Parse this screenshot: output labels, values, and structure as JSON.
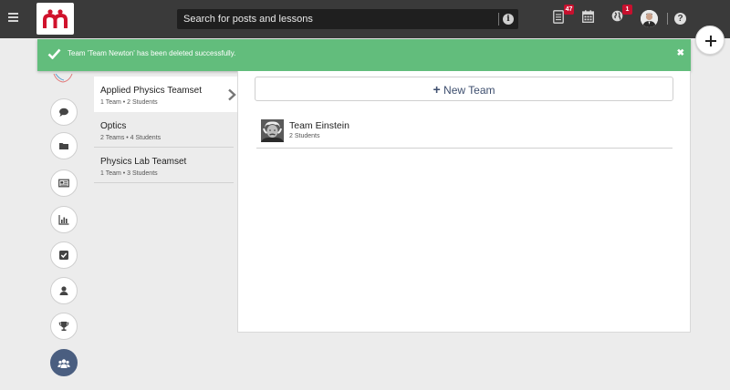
{
  "header": {
    "search_placeholder": "Search for posts and lessons",
    "notifications": [
      {
        "icon": "document-icon",
        "badge": "47"
      },
      {
        "icon": "calendar-icon",
        "badge": ""
      },
      {
        "icon": "globe-icon",
        "badge": "1"
      }
    ],
    "help_label": "?"
  },
  "toast": {
    "message": "Team 'Team Newton' has been deleted successfully.",
    "close": "✖"
  },
  "sidebar": {
    "items": [
      {
        "name": "comment-icon"
      },
      {
        "name": "folder-icon"
      },
      {
        "name": "newspaper-icon"
      },
      {
        "name": "bar-chart-icon"
      },
      {
        "name": "checkbox-icon"
      },
      {
        "name": "user-icon"
      },
      {
        "name": "trophy-icon"
      },
      {
        "name": "group-icon",
        "active": true
      }
    ]
  },
  "teamsets": [
    {
      "name": "Applied Physics Teamset",
      "meta": "1 Team • 2 Students",
      "selected": true
    },
    {
      "name": "Optics",
      "meta": "2 Teams • 4 Students"
    },
    {
      "name": "Physics Lab Teamset",
      "meta": "1 Team • 3 Students"
    }
  ],
  "main": {
    "new_team_plus": "+",
    "new_team_label": "New Team",
    "teams": [
      {
        "name": "Team Einstein",
        "meta": "2 Students"
      }
    ]
  },
  "colors": {
    "topbar": "#3a3a3a",
    "toast": "#62bd7c",
    "accent": "#4a5e80",
    "badge": "#c8102e",
    "brand": "#d0122c"
  }
}
